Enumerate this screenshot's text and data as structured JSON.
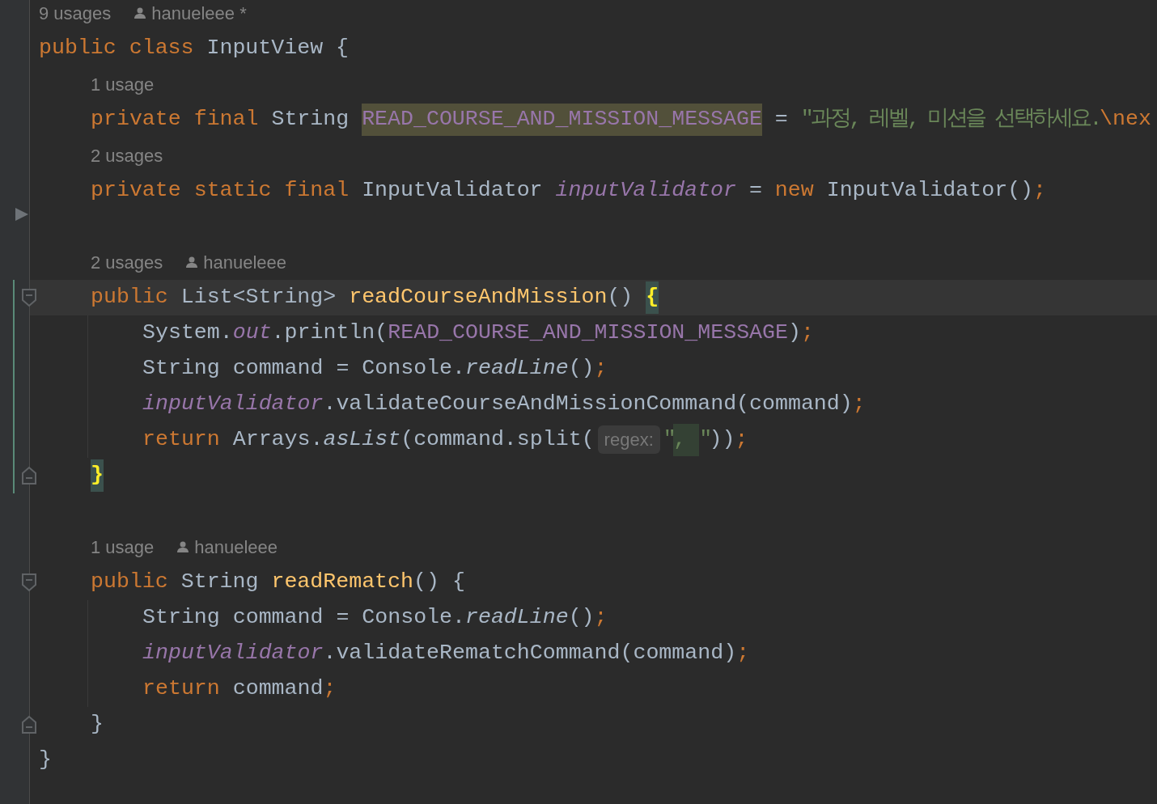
{
  "lines": [
    {
      "kind": "usages",
      "usages": "9 usages",
      "author": "hanueleee *"
    },
    {
      "kind": "code",
      "tokens": [
        {
          "text": "public class ",
          "kind": "keyword"
        },
        {
          "text": "InputView {",
          "kind": "plain"
        }
      ],
      "children": [
        {
          "kind": "usages",
          "usages": "1 usage"
        },
        {
          "kind": "code",
          "tokens": [
            {
              "text": "private final ",
              "kind": "keyword"
            },
            {
              "text": "String ",
              "kind": "plain"
            },
            {
              "text": "READ_COURSE_AND_MISSION_MESSAGE",
              "kind": "constant-highlighted"
            },
            {
              "text": " = ",
              "kind": "plain"
            },
            {
              "text": "\"과정, 레벨, 미션을 선택하세요.",
              "kind": "string"
            },
            {
              "text": "\\nex",
              "kind": "escape"
            }
          ]
        },
        {
          "kind": "usages",
          "usages": "2 usages"
        },
        {
          "kind": "code",
          "tokens": [
            {
              "text": "private static final ",
              "kind": "keyword"
            },
            {
              "text": "InputValidator ",
              "kind": "plain"
            },
            {
              "text": "inputValidator",
              "kind": "static-field"
            },
            {
              "text": " = ",
              "kind": "plain"
            },
            {
              "text": "new ",
              "kind": "keyword"
            },
            {
              "text": "InputValidator()",
              "kind": "plain"
            },
            {
              "text": ";",
              "kind": "semicolon"
            }
          ]
        },
        {
          "kind": "blank",
          "marker": {
            "kind": "run-arrow"
          }
        },
        {
          "kind": "usages",
          "usages": "2 usages",
          "author": "hanueleee"
        },
        {
          "kind": "code",
          "marker": {
            "kind": "fold-start"
          },
          "changed": true,
          "current": true,
          "tokens": [
            {
              "text": "public ",
              "kind": "keyword"
            },
            {
              "text": "List<String> ",
              "kind": "plain"
            },
            {
              "text": "readCourseAndMission",
              "kind": "method-decl"
            },
            {
              "text": "() ",
              "kind": "plain"
            },
            {
              "text": "{",
              "kind": "brace-match"
            }
          ],
          "children": [
            {
              "kind": "code",
              "changed": true,
              "tokens": [
                {
                  "text": "System.",
                  "kind": "plain"
                },
                {
                  "text": "out",
                  "kind": "static-field"
                },
                {
                  "text": ".println(",
                  "kind": "plain"
                },
                {
                  "text": "READ_COURSE_AND_MISSION_MESSAGE",
                  "kind": "constant"
                },
                {
                  "text": ")",
                  "kind": "plain"
                },
                {
                  "text": ";",
                  "kind": "semicolon"
                }
              ]
            },
            {
              "kind": "code",
              "changed": true,
              "tokens": [
                {
                  "text": "String command = Console.",
                  "kind": "plain"
                },
                {
                  "text": "readLine",
                  "kind": "static-method"
                },
                {
                  "text": "()",
                  "kind": "plain"
                },
                {
                  "text": ";",
                  "kind": "semicolon"
                }
              ]
            },
            {
              "kind": "code",
              "changed": true,
              "tokens": [
                {
                  "text": "inputValidator",
                  "kind": "static-field"
                },
                {
                  "text": ".validateCourseAndMissionCommand(command)",
                  "kind": "plain"
                },
                {
                  "text": ";",
                  "kind": "semicolon"
                }
              ]
            },
            {
              "kind": "code",
              "changed": true,
              "tokens": [
                {
                  "text": "return ",
                  "kind": "keyword"
                },
                {
                  "text": "Arrays.",
                  "kind": "plain"
                },
                {
                  "text": "asList",
                  "kind": "static-method"
                },
                {
                  "text": "(command.split(",
                  "kind": "plain"
                },
                {
                  "text": "regex:",
                  "kind": "inlay"
                },
                {
                  "text": "\"",
                  "kind": "string"
                },
                {
                  "text": ", ",
                  "kind": "string-selected"
                },
                {
                  "text": "\"",
                  "kind": "string"
                },
                {
                  "text": "))",
                  "kind": "plain"
                },
                {
                  "text": ";",
                  "kind": "semicolon"
                }
              ]
            }
          ]
        },
        {
          "kind": "code",
          "marker": {
            "kind": "fold-end"
          },
          "changed": true,
          "tokens": [
            {
              "text": "}",
              "kind": "brace-match"
            }
          ]
        },
        {
          "kind": "blank"
        },
        {
          "kind": "usages",
          "usages": "1 usage",
          "author": "hanueleee"
        },
        {
          "kind": "code",
          "marker": {
            "kind": "fold-start"
          },
          "tokens": [
            {
              "text": "public ",
              "kind": "keyword"
            },
            {
              "text": "String ",
              "kind": "plain"
            },
            {
              "text": "readRematch",
              "kind": "method-decl"
            },
            {
              "text": "() {",
              "kind": "plain"
            }
          ],
          "children": [
            {
              "kind": "code",
              "tokens": [
                {
                  "text": "String command = Console.",
                  "kind": "plain"
                },
                {
                  "text": "readLine",
                  "kind": "static-method"
                },
                {
                  "text": "()",
                  "kind": "plain"
                },
                {
                  "text": ";",
                  "kind": "semicolon"
                }
              ]
            },
            {
              "kind": "code",
              "tokens": [
                {
                  "text": "inputValidator",
                  "kind": "static-field"
                },
                {
                  "text": ".validateRematchCommand(command)",
                  "kind": "plain"
                },
                {
                  "text": ";",
                  "kind": "semicolon"
                }
              ]
            },
            {
              "kind": "code",
              "tokens": [
                {
                  "text": "return ",
                  "kind": "keyword"
                },
                {
                  "text": "command",
                  "kind": "plain"
                },
                {
                  "text": ";",
                  "kind": "semicolon"
                }
              ]
            }
          ]
        },
        {
          "kind": "code",
          "marker": {
            "kind": "fold-end"
          },
          "tokens": [
            {
              "text": "}",
              "kind": "plain"
            }
          ]
        }
      ]
    },
    {
      "kind": "code",
      "tokens": [
        {
          "text": "}",
          "kind": "plain"
        }
      ]
    }
  ]
}
